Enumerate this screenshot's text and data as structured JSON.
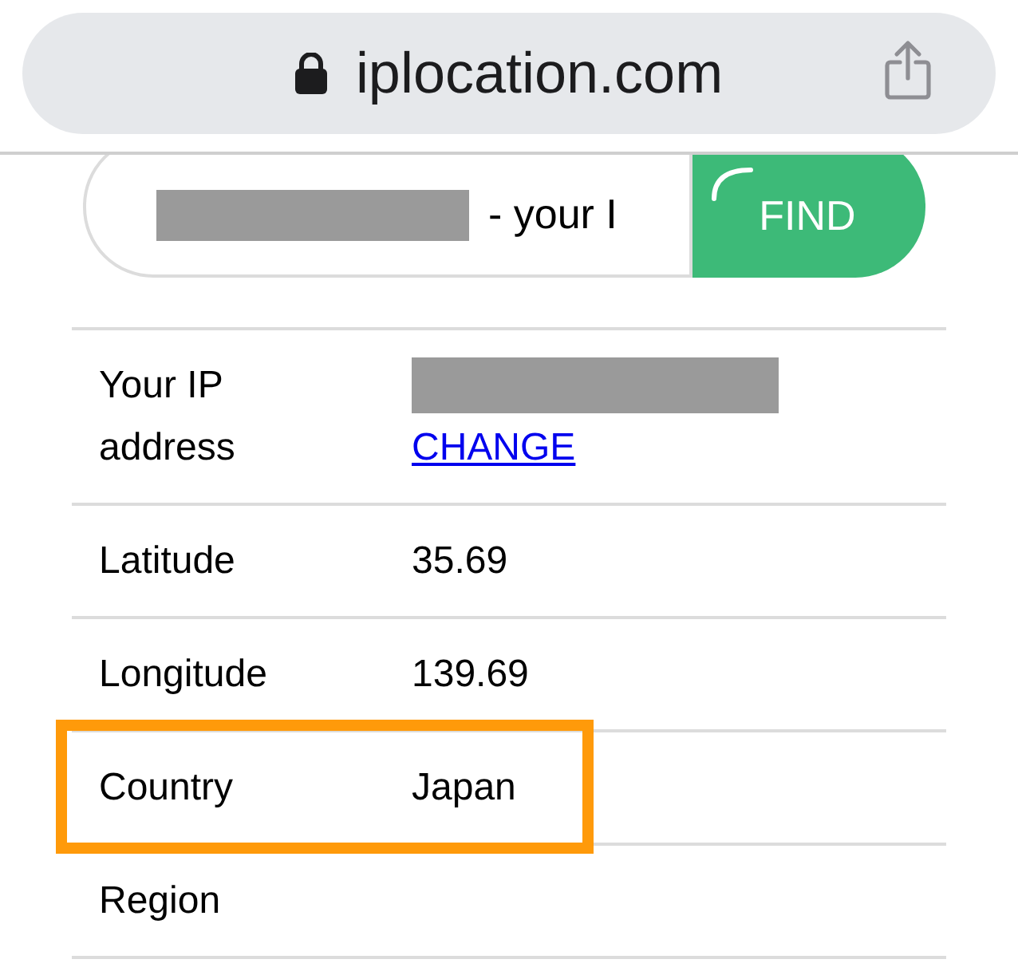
{
  "browser": {
    "url": "iplocation.com",
    "secure": true
  },
  "search": {
    "value": "- your I",
    "redacted": true
  },
  "find_button": {
    "label": "FIND",
    "loading": true
  },
  "table": {
    "rows": [
      {
        "kind": "ip",
        "label": "Your IP address",
        "redacted": true,
        "link": "CHANGE",
        "highlighted": false
      },
      {
        "kind": "text",
        "label": "Latitude",
        "value": "35.69",
        "highlighted": false
      },
      {
        "kind": "text",
        "label": "Longitude",
        "value": "139.69",
        "highlighted": false
      },
      {
        "kind": "text",
        "label": "Country",
        "value": "Japan",
        "highlighted": true
      },
      {
        "kind": "text",
        "label": "Region",
        "highlighted": false
      }
    ]
  }
}
